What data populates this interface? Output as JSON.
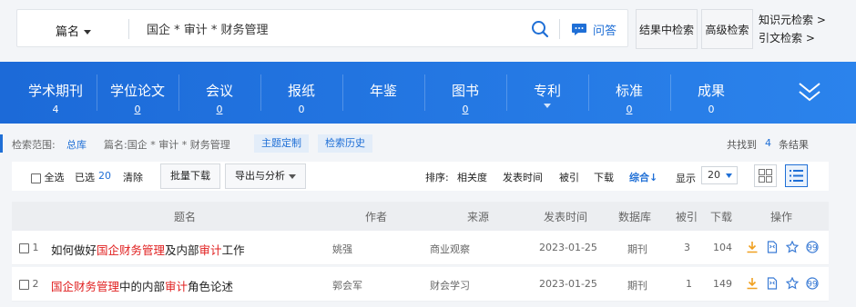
{
  "search": {
    "field_label": "篇名",
    "query": "国企 * 审计 * 财务管理",
    "qa_label": "问答",
    "in_result_btn": "结果中检索",
    "advanced_btn": "高级检索",
    "links": [
      "知识元检索 >",
      "引文检索 >"
    ]
  },
  "nav": [
    {
      "label": "学术期刊",
      "count": "4",
      "underline": false
    },
    {
      "label": "学位论文",
      "count": "0",
      "underline": true
    },
    {
      "label": "会议",
      "count": "0",
      "underline": true
    },
    {
      "label": "报纸",
      "count": "0",
      "underline": false
    },
    {
      "label": "年鉴",
      "count": "",
      "underline": false
    },
    {
      "label": "图书",
      "count": "0",
      "underline": true
    },
    {
      "label": "专利",
      "count": "",
      "underline": true
    },
    {
      "label": "标准",
      "count": "0",
      "underline": true
    },
    {
      "label": "成果",
      "count": "0",
      "underline": false
    }
  ],
  "scope": {
    "label": "检索范围:",
    "db": "总库",
    "query_text": "篇名:国企 * 审计 * 财务管理",
    "topic_btn": "主题定制",
    "history_btn": "检索历史",
    "found_prefix": "共找到",
    "found_count": "4",
    "found_suffix": "条结果"
  },
  "toolbar": {
    "select_all": "全选",
    "selected_label": "已选",
    "selected_count": "20",
    "clear": "清除",
    "batch_download": "批量下载",
    "export": "导出与分析",
    "sort_label": "排序:",
    "sort_options": [
      "相关度",
      "发表时间",
      "被引",
      "下载",
      "综合"
    ],
    "sort_active_arrow": "↓",
    "display_label": "显示",
    "page_size": "20"
  },
  "table": {
    "headers": [
      "题名",
      "作者",
      "来源",
      "发表时间",
      "数据库",
      "被引",
      "下载",
      "操作"
    ],
    "rows": [
      {
        "index": "1",
        "title_parts": [
          {
            "text": "如何做好",
            "hl": false
          },
          {
            "text": "国企财务管理",
            "hl": true
          },
          {
            "text": "及内部",
            "hl": false
          },
          {
            "text": "审计",
            "hl": true
          },
          {
            "text": "工作",
            "hl": false
          }
        ],
        "author": "姚强",
        "source": "商业观察",
        "date": "2023-01-25",
        "db": "期刊",
        "cited": "3",
        "downloads": "104"
      },
      {
        "index": "2",
        "title_parts": [
          {
            "text": "国企财务管理",
            "hl": true
          },
          {
            "text": "中的内部",
            "hl": false
          },
          {
            "text": "审计",
            "hl": true
          },
          {
            "text": "角色论述",
            "hl": false
          }
        ],
        "author": "郭会军",
        "source": "财会学习",
        "date": "2023-01-25",
        "db": "期刊",
        "cited": "1",
        "downloads": "149"
      }
    ]
  },
  "colors": {
    "nav_blue": "#2078e2",
    "link_blue": "#1f6fd6",
    "highlight_red": "#e02020",
    "action_orange": "#f0a020"
  }
}
